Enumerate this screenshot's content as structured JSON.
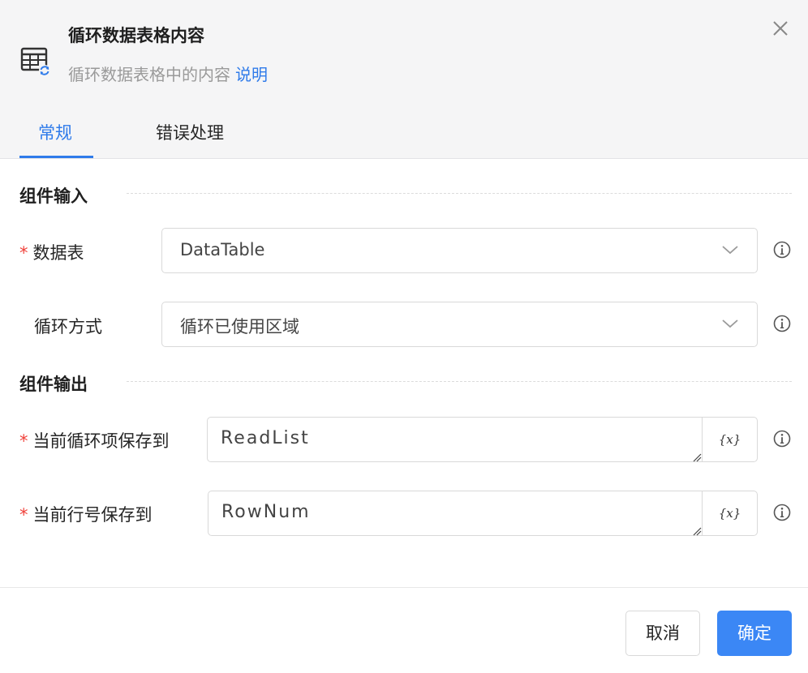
{
  "dialog": {
    "title": "循环数据表格内容",
    "subtitle": "循环数据表格中的内容",
    "help_link": "说明",
    "close_icon": "close-icon",
    "app_icon": "table-loop-icon"
  },
  "tabs": [
    {
      "label": "常规",
      "active": true
    },
    {
      "label": "错误处理",
      "active": false
    }
  ],
  "sections": {
    "input": "组件输入",
    "output": "组件输出"
  },
  "fields": {
    "datatable": {
      "required_mark": "*",
      "label": "数据表",
      "value": "DataTable"
    },
    "loop_mode": {
      "label": "循环方式",
      "value": "循环已使用区域"
    },
    "current_item": {
      "required_mark": "*",
      "label": "当前循环项保存到",
      "value": "ReadList",
      "var_button": "{x}"
    },
    "current_row": {
      "required_mark": "*",
      "label": "当前行号保存到",
      "value": "RowNum",
      "var_button": "{x}"
    }
  },
  "buttons": {
    "cancel": "取消",
    "ok": "确定"
  },
  "colors": {
    "accent": "#2f7bea",
    "primary_button": "#3b87f5",
    "required": "#f0413a",
    "header_bg": "#f5f5f6"
  }
}
